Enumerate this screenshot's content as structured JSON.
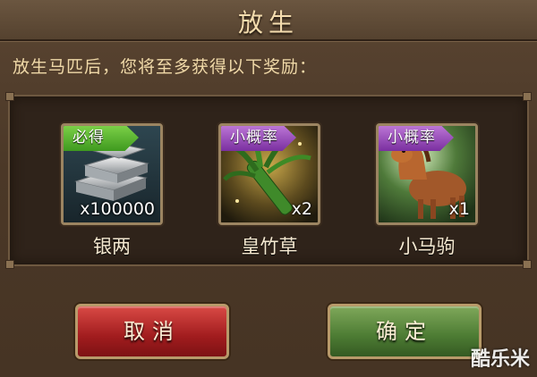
{
  "dialog": {
    "title": "放生",
    "subtitle": "放生马匹后，您将至多获得以下奖励："
  },
  "rewards": [
    {
      "tag": "必得",
      "tag_color": "#4fae2a",
      "quantity": "x100000",
      "name": "银两",
      "icon": "silver-ingots-icon"
    },
    {
      "tag": "小概率",
      "tag_color": "#8e3db5",
      "quantity": "x2",
      "name": "皇竹草",
      "icon": "bamboo-grass-icon"
    },
    {
      "tag": "小概率",
      "tag_color": "#8e3db5",
      "quantity": "x1",
      "name": "小马驹",
      "icon": "pony-icon"
    }
  ],
  "buttons": {
    "cancel_label": "取消",
    "confirm_label": "确定"
  },
  "watermark": "酷乐米"
}
